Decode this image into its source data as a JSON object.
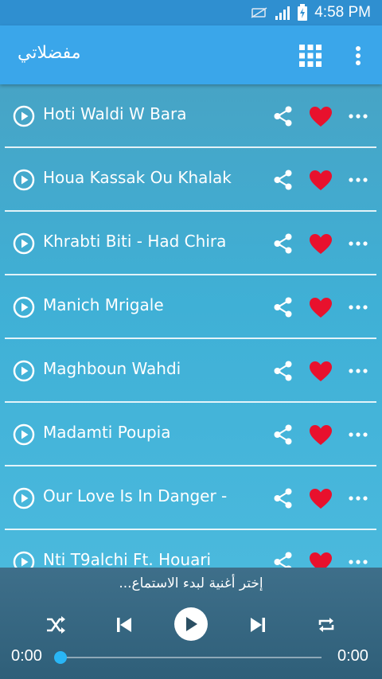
{
  "status_bar": {
    "time": "4:58 PM"
  },
  "app_bar": {
    "title": "مفضلاتي"
  },
  "songs": [
    {
      "title": "Hoti Waldi W Bara"
    },
    {
      "title": "Houa Kassak Ou Khalak"
    },
    {
      "title": "Khrabti Biti - Had Chira"
    },
    {
      "title": "Manich Mrigale"
    },
    {
      "title": "Maghboun Wahdi"
    },
    {
      "title": "Madamti Poupia"
    },
    {
      "title": "Our Love Is In Danger -"
    },
    {
      "title": "Nti T9alchi Ft. Houari"
    }
  ],
  "player": {
    "message": "إختر أغنية لبدء الاستماع...",
    "time_elapsed": "0:00",
    "time_total": "0:00",
    "progress": 0
  },
  "colors": {
    "heart": "#e8112d",
    "accent": "#29b6f6",
    "app_bar": "#3aa6ea"
  }
}
